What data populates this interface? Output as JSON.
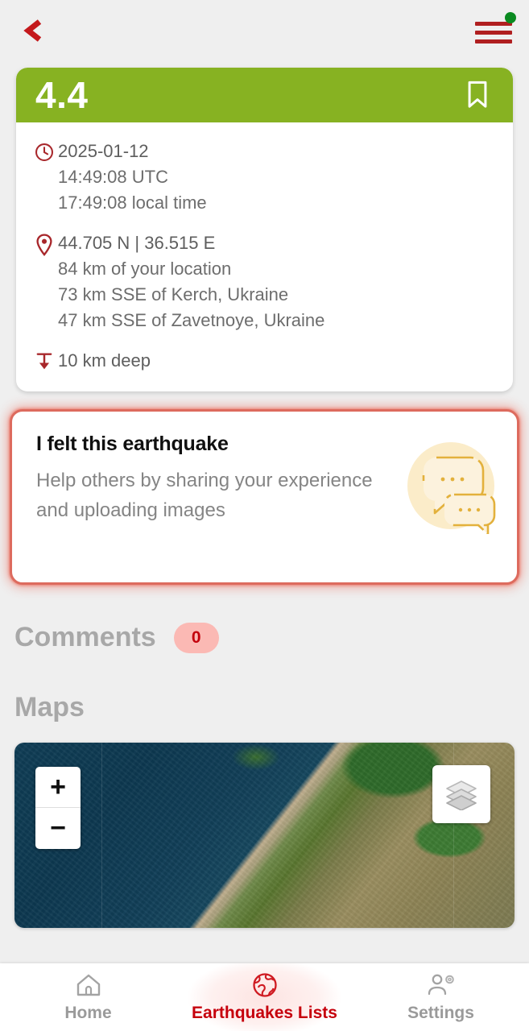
{
  "topbar": {
    "back_label": "<",
    "back_icon": "chevron-left-icon",
    "menu_icon": "hamburger-menu-icon",
    "menu_badge_color": "#0a8a20"
  },
  "quake": {
    "magnitude": "4.4",
    "header_color": "#87b222",
    "bookmark_icon": "bookmark-icon",
    "time": {
      "icon": "clock-icon",
      "date": "2025-01-12",
      "utc": "14:49:08 UTC",
      "local": "17:49:08 local time"
    },
    "location": {
      "icon": "map-pin-icon",
      "coordinates": "44.705 N | 36.515 E",
      "distance_user": "84 km of your location",
      "nearest_city": "73 km SSE of Kerch, Ukraine",
      "nearest_town": "47 km SSE of Zavetnoye, Ukraine"
    },
    "depth": {
      "icon": "depth-arrow-icon",
      "value": "10 km deep"
    }
  },
  "felt_card": {
    "title": "I felt this earthquake",
    "subtitle": "Help others by sharing your experience and uploading images",
    "illustration_icon": "chat-bubbles-icon",
    "border_color": "#dd6b5e",
    "glow_color": "#eb503c"
  },
  "comments": {
    "title": "Comments",
    "count": "0",
    "badge_bg": "#fbb9b4",
    "badge_text_color": "#c3000b"
  },
  "maps": {
    "title": "Maps",
    "zoom_in_label": "+",
    "zoom_out_label": "−",
    "zoom_in_icon": "zoom-in-icon",
    "zoom_out_icon": "zoom-out-icon",
    "layers_icon": "map-layers-icon"
  },
  "bottom_nav": {
    "items": [
      {
        "label": "Home",
        "icon": "home-icon",
        "active": false
      },
      {
        "label": "Earthquakes Lists",
        "icon": "globe-icon",
        "active": true
      },
      {
        "label": "Settings",
        "icon": "user-settings-icon",
        "active": false
      }
    ]
  }
}
